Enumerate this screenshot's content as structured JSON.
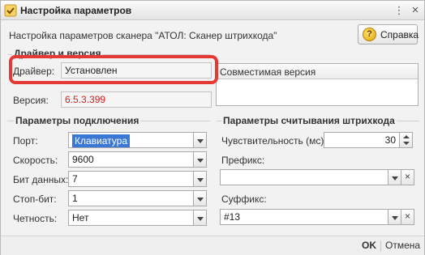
{
  "window": {
    "title": "Настройка параметров",
    "more_icon": "⋮",
    "close_icon": "×"
  },
  "header": {
    "subtitle": "Настройка параметров сканера \"АТОЛ: Сканер штрихкода\"",
    "help_label": "Справка",
    "help_icon": "?"
  },
  "driver_group": {
    "title": "Драйвер и версия",
    "driver_label": "Драйвер:",
    "driver_value": "Установлен",
    "version_label": "Версия:",
    "version_value": "6.5.3.399",
    "compat_header": "Совместимая версия"
  },
  "connection": {
    "title": "Параметры подключения",
    "port_label": "Порт:",
    "port_value": "Клавиатура",
    "speed_label": "Скорость:",
    "speed_value": "9600",
    "databits_label": "Бит данных:",
    "databits_value": "7",
    "stopbits_label": "Стоп-бит:",
    "stopbits_value": "1",
    "parity_label": "Четность:",
    "parity_value": "Нет"
  },
  "reading": {
    "title": "Параметры считывания штрихкода",
    "sensitivity_label": "Чувствительность (мс):",
    "sensitivity_value": "30",
    "prefix_label": "Префикс:",
    "prefix_value": "",
    "suffix_label": "Суффикс:",
    "suffix_value": "#13",
    "clear_icon": "×"
  },
  "footer": {
    "ok_label": "OK",
    "cancel_label": "Отмена"
  },
  "colors": {
    "highlight_box": "#e53935",
    "version_text": "#d32020",
    "selection": "#3a78d6"
  }
}
